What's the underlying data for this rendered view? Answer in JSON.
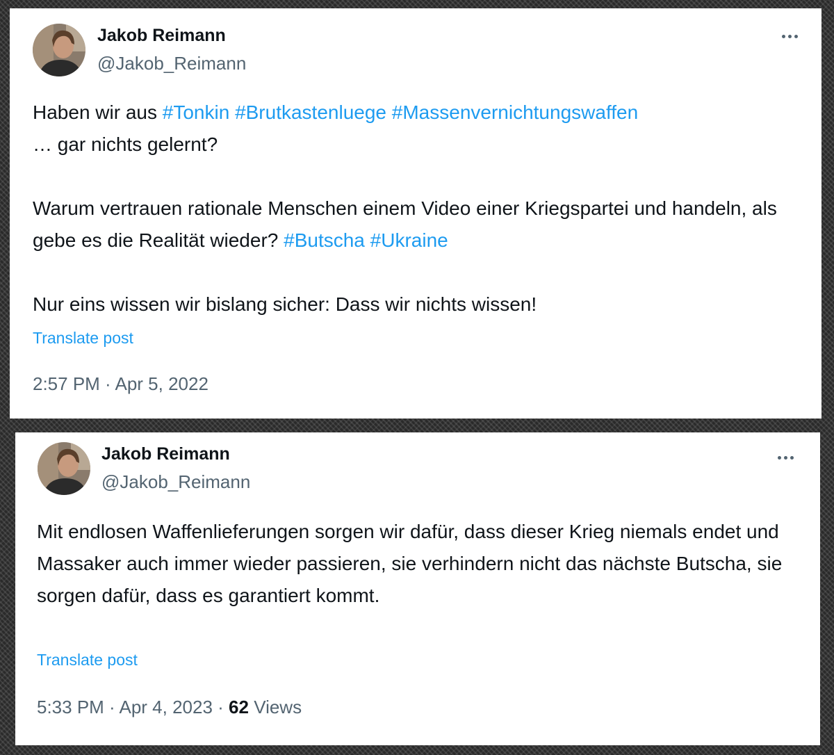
{
  "tweets": [
    {
      "author": {
        "name": "Jakob Reimann",
        "handle": "@Jakob_Reimann"
      },
      "more_label": "More",
      "body": {
        "line1_prefix": "Haben wir aus ",
        "hashtag_tonkin": "#Tonkin",
        "hashtag_brutkasten": "#Brutkastenluege",
        "hashtag_mvw": "#Massenvernichtungswaffen",
        "line2": "… gar nichts gelernt?",
        "para2_text": "Warum vertrauen rationale Menschen einem Video einer Kriegspartei und handeln, als gebe es die Realität wieder? ",
        "hashtag_butscha": "#Butscha",
        "hashtag_ukraine": "#Ukraine",
        "para3": "Nur eins wissen wir bislang sicher: Dass wir nichts wissen!"
      },
      "translate_label": "Translate post",
      "time": "2:57 PM",
      "separator": " · ",
      "date": "Apr 5, 2022"
    },
    {
      "author": {
        "name": "Jakob Reimann",
        "handle": "@Jakob_Reimann"
      },
      "more_label": "More",
      "body": {
        "text": "Mit endlosen Waffenlieferungen sorgen wir dafür, dass dieser Krieg niemals endet und Massaker auch immer wieder passieren, sie verhindern nicht das nächste Butscha, sie sorgen dafür, dass es garantiert kommt."
      },
      "translate_label": "Translate post",
      "time": "5:33 PM",
      "separator": " · ",
      "date": "Apr 4, 2023",
      "separator2": " · ",
      "views_count": "62",
      "views_label": " Views"
    }
  ],
  "colors": {
    "link": "#1d9bf0",
    "text": "#0f1419",
    "muted": "#536471"
  }
}
